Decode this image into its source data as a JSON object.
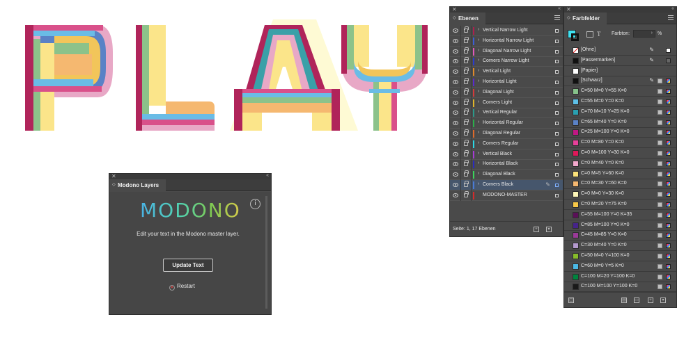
{
  "artwork": {
    "word": "PLAY"
  },
  "ebenen": {
    "tab": "Ebenen",
    "footer_info": "Seite: 1, 17 Ebenen",
    "layers": [
      {
        "name": "Vertical Narrow Light",
        "color": "#b01e4e"
      },
      {
        "name": "Horizontal Narrow Light",
        "color": "#3b5fd6"
      },
      {
        "name": "Diagonal Narrow Light",
        "color": "#e25ab9"
      },
      {
        "name": "Corners Narrow Light",
        "color": "#2a3bd0"
      },
      {
        "name": "Vertical Light",
        "color": "#e08a2a"
      },
      {
        "name": "Horizontal Light",
        "color": "#5a2ad0"
      },
      {
        "name": "Diagonal Light",
        "color": "#d63a3a"
      },
      {
        "name": "Corners Light",
        "color": "#e0b52a"
      },
      {
        "name": "Vertical Regular",
        "color": "#2a9a8a"
      },
      {
        "name": "Horizontal Regular",
        "color": "#2ab04a"
      },
      {
        "name": "Diagonal Regular",
        "color": "#e06a2a"
      },
      {
        "name": "Corners Regular",
        "color": "#2ad8e6"
      },
      {
        "name": "Vertical Black",
        "color": "#a63ad6"
      },
      {
        "name": "Horizontal Black",
        "color": "#2a2ac0"
      },
      {
        "name": "Diagonal Black",
        "color": "#3ad65a"
      },
      {
        "name": "Corners Black",
        "color": "#4a7bd6",
        "selected": true
      },
      {
        "name": "MODONO-MASTER",
        "color": "#d62a2a",
        "no_expand": true
      }
    ]
  },
  "farbfelder": {
    "tab": "Farbfelder",
    "farbton_label": "Farbton:",
    "farbton_unit": "%",
    "swatches": [
      {
        "name": "[Ohne]",
        "color": "none",
        "special": "ohne"
      },
      {
        "name": "[Passermarken]",
        "color": "#111111",
        "special": "passer"
      },
      {
        "name": "[Papier]",
        "color": "#ffffff",
        "special": "papier"
      },
      {
        "name": "[Schwarz]",
        "color": "#111111",
        "special": "schwarz"
      },
      {
        "name": "C=50 M=0 Y=55 K=0",
        "color": "#86c28a"
      },
      {
        "name": "C=55 M=0 Y=0 K=0",
        "color": "#5ec0e8"
      },
      {
        "name": "C=70 M=10 Y=25 K=0",
        "color": "#2aa0b0"
      },
      {
        "name": "C=65 M=40 Y=0 K=0",
        "color": "#5a82c6"
      },
      {
        "name": "C=25 M=100 Y=0 K=0",
        "color": "#c01884"
      },
      {
        "name": "C=0 M=80 Y=0 K=0",
        "color": "#e8409a"
      },
      {
        "name": "C=0 M=100 Y=30 K=0",
        "color": "#e0185a"
      },
      {
        "name": "C=0 M=40 Y=0 K=0",
        "color": "#f2a8cc"
      },
      {
        "name": "C=0 M=5 Y=60 K=0",
        "color": "#fbe27a"
      },
      {
        "name": "C=0 M=30 Y=60 K=0",
        "color": "#f5b870"
      },
      {
        "name": "C=0 M=0 Y=30 K=0",
        "color": "#fdf6b8"
      },
      {
        "name": "C=0 M=20 Y=75 K=0",
        "color": "#f7c848"
      },
      {
        "name": "C=55 M=100 Y=0 K=35",
        "color": "#5a1058"
      },
      {
        "name": "C=85 M=100 Y=0 K=0",
        "color": "#46248a"
      },
      {
        "name": "C=45 M=85 Y=0 K=0",
        "color": "#9a3a98"
      },
      {
        "name": "C=30 M=40 Y=0 K=0",
        "color": "#b49ace"
      },
      {
        "name": "C=50 M=0 Y=100 K=0",
        "color": "#86bc2a"
      },
      {
        "name": "C=60 M=0 Y=5 K=0",
        "color": "#4ab8e4"
      },
      {
        "name": "C=100 M=20 Y=100 K=0",
        "color": "#00843e"
      },
      {
        "name": "C=100 M=100 Y=100 K=0",
        "color": "#1a1a1a"
      }
    ]
  },
  "modono": {
    "tab": "Modono Layers",
    "logo": "MODONO",
    "info": "i",
    "description": "Edit your text in the Modono master layer.",
    "update_button": "Update Text",
    "restart": "Restart"
  }
}
